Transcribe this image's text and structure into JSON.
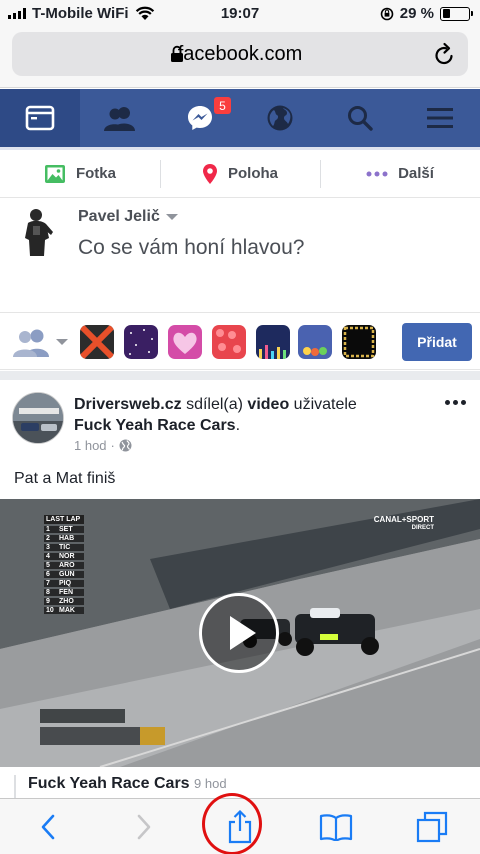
{
  "status_bar": {
    "carrier": "T-Mobile WiFi",
    "time": "19:07",
    "battery_percent_label": "29 %",
    "battery_level": 0.29
  },
  "browser": {
    "url": "facebook.com"
  },
  "fb_nav": {
    "tabs": [
      {
        "name": "news-feed-icon",
        "active": true
      },
      {
        "name": "friends-icon",
        "active": false
      },
      {
        "name": "messenger-icon",
        "active": false,
        "badge": "5"
      },
      {
        "name": "globe-icon",
        "active": false
      },
      {
        "name": "search-icon",
        "active": false
      },
      {
        "name": "menu-icon",
        "active": false
      }
    ]
  },
  "composer": {
    "actions": [
      "Fotka",
      "Poloha",
      "Další"
    ],
    "user_name": "Pavel Jelič",
    "placeholder": "Co se vám honí hlavou?",
    "post_button": "Přidat"
  },
  "post": {
    "author": "Driversweb.cz",
    "verb": "sdílel(a)",
    "object": "video",
    "object_suffix": "uživatele",
    "page": "Fuck Yeah Race Cars",
    "period": ".",
    "time": "1 hod",
    "text": "Pat a Mat finiš",
    "shared_author": "Fuck Yeah Race Cars",
    "shared_time": "9 hod"
  },
  "video_overlay": {
    "leaderboard_title": "LAST LAP",
    "drivers": [
      {
        "pos": "1",
        "code": "SET"
      },
      {
        "pos": "2",
        "code": "HAB"
      },
      {
        "pos": "3",
        "code": "TIC"
      },
      {
        "pos": "4",
        "code": "NOR"
      },
      {
        "pos": "5",
        "code": "ARO"
      },
      {
        "pos": "6",
        "code": "GUN"
      },
      {
        "pos": "7",
        "code": "PIQ"
      },
      {
        "pos": "8",
        "code": "FEN"
      },
      {
        "pos": "9",
        "code": "ZHO"
      },
      {
        "pos": "10",
        "code": "MAK"
      }
    ],
    "broadcaster": "CANAL+SPORT",
    "broadcaster_sub": "DIRECT"
  },
  "colors": {
    "facebook_blue": "#3b5998",
    "button_blue": "#4267b2",
    "ios_blue": "#1a7cf5",
    "highlight_red": "#e01010"
  }
}
